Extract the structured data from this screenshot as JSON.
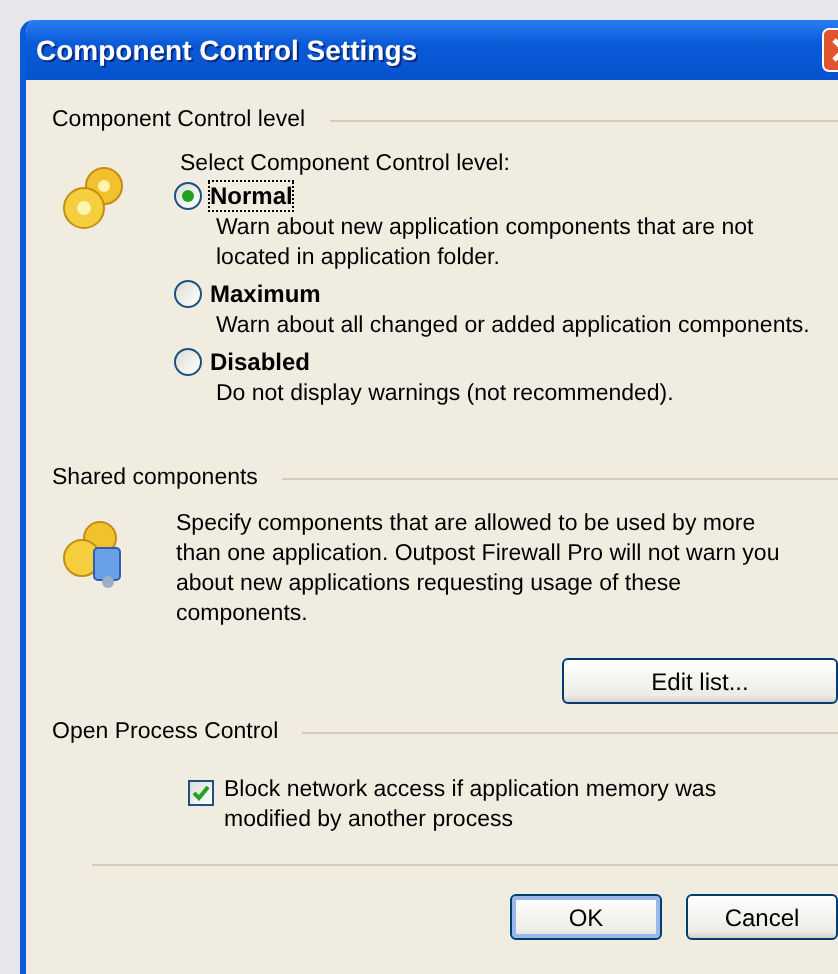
{
  "window": {
    "title": "Component Control Settings"
  },
  "control_level": {
    "heading": "Component Control level",
    "prompt": "Select Component Control level:",
    "options": [
      {
        "label": "Normal",
        "description": "Warn about new application components that are not located in application folder.",
        "selected": true
      },
      {
        "label": "Maximum",
        "description": "Warn about all changed or added application components.",
        "selected": false
      },
      {
        "label": "Disabled",
        "description": "Do not display warnings (not recommended).",
        "selected": false
      }
    ]
  },
  "shared_components": {
    "heading": "Shared components",
    "description": "Specify components that are allowed to be used by more than one application. Outpost Firewall Pro will not warn you about new applications requesting usage of these components.",
    "button": "Edit list..."
  },
  "open_process_control": {
    "heading": "Open Process Control",
    "checkbox": {
      "label": "Block network access if application memory was modified by another process",
      "checked": true
    }
  },
  "buttons": [
    "OK",
    "Cancel"
  ]
}
